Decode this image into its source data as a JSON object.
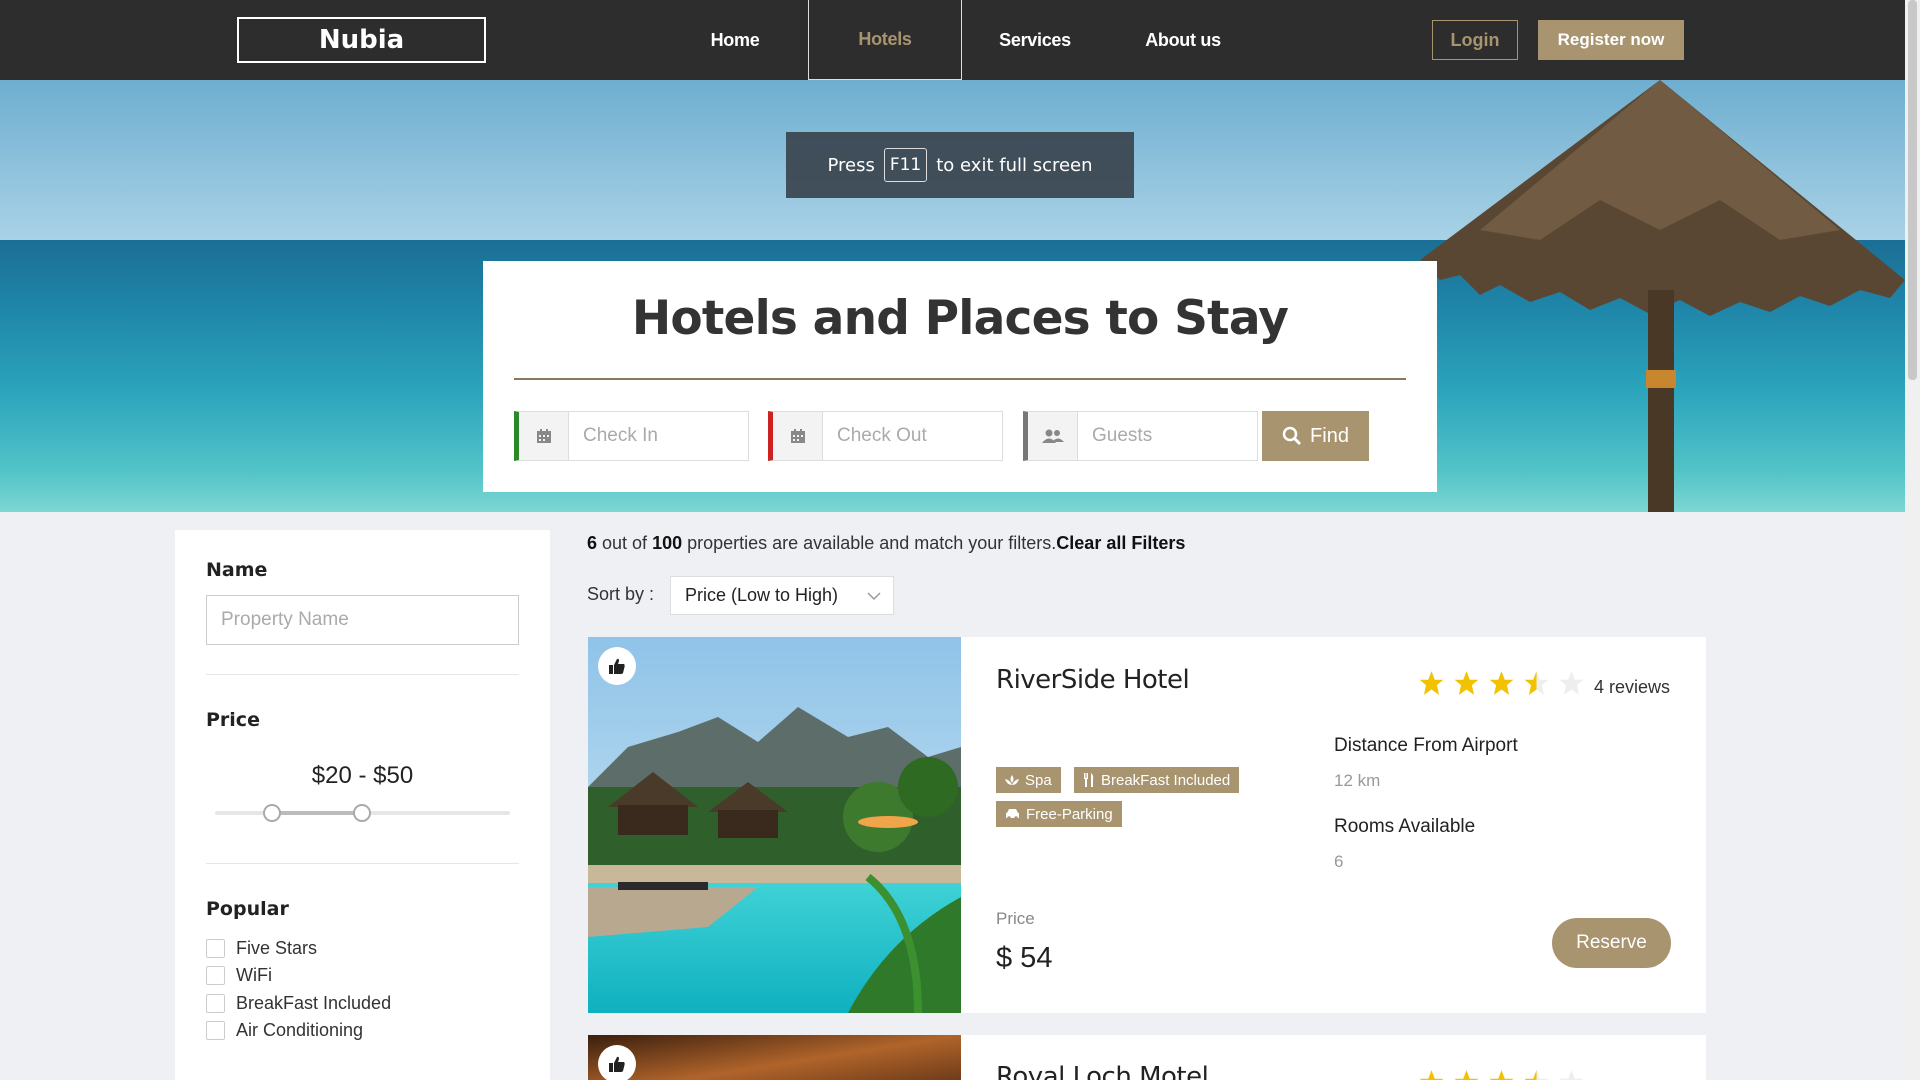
{
  "nav": {
    "logo": "Nubia",
    "links": [
      "Home",
      "Hotels",
      "Services",
      "About us"
    ],
    "active": "Hotels",
    "login": "Login",
    "register": "Register now"
  },
  "fullscreen_toast": {
    "pre": "Press",
    "key": "F11",
    "post": "to exit full screen"
  },
  "search": {
    "title": "Hotels and Places to Stay",
    "checkin_placeholder": "Check In",
    "checkout_placeholder": "Check Out",
    "guests_placeholder": "Guests",
    "find_label": "Find"
  },
  "sidebar": {
    "name_heading": "Name",
    "name_placeholder": "Property Name",
    "price_heading": "Price",
    "price_range": "$20 - $50",
    "popular_heading": "Popular",
    "popular_options": [
      "Five Stars",
      "WiFi",
      "BreakFast Included",
      "Air Conditioning"
    ]
  },
  "results": {
    "count": "6",
    "out_of": " out of ",
    "total": "100",
    "suffix": " properties are available and match your filters.",
    "clear": "Clear all Filters",
    "sort_label": "Sort by :",
    "sort_value": "Price (Low to High)"
  },
  "hotels": [
    {
      "name": "RiverSide Hotel",
      "rating": 3.5,
      "reviews": "4 reviews",
      "tags": [
        "Spa",
        "BreakFast Included",
        "Free-Parking"
      ],
      "distance_label": "Distance From Airport",
      "distance": "12 km",
      "rooms_label": "Rooms Available",
      "rooms": "6",
      "price_label": "Price",
      "price": "$ 54",
      "reserve": "Reserve"
    },
    {
      "name": "Royal Loch Motel"
    }
  ],
  "colors": {
    "accent": "#a8946e",
    "nav_bg": "#2d2d2d",
    "checkin_bar": "#2a8a2a",
    "checkout_bar": "#cc2222",
    "star": "#f2c200"
  }
}
